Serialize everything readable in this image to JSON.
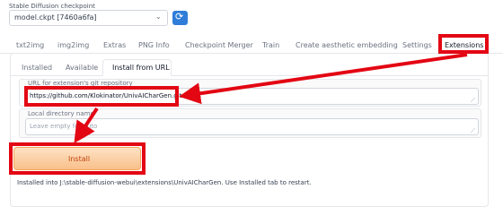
{
  "checkpoint": {
    "label": "Stable Diffusion checkpoint",
    "value": "model.ckpt [7460a6fa]"
  },
  "tabs": [
    "txt2img",
    "img2img",
    "Extras",
    "PNG Info",
    "Checkpoint Merger",
    "Train",
    "Create aesthetic embedding",
    "Settings",
    "Extensions"
  ],
  "subtabs": [
    "Installed",
    "Available",
    "Install from URL"
  ],
  "url_field": {
    "label": "URL for extension's git repository",
    "value": "https://github.com/Klokinator/UnivAICharGen.git"
  },
  "dir_field": {
    "label": "Local directory name",
    "placeholder": "Leave empty for auto"
  },
  "install_button": "Install",
  "status": "Installed into J:\\stable-diffusion-webui\\extensions\\UnivAICharGen. Use Installed tab to restart.",
  "colors": {
    "highlight": "#e30613",
    "refresh_button": "#2f7dd9",
    "install_button": "#f9c08a"
  }
}
